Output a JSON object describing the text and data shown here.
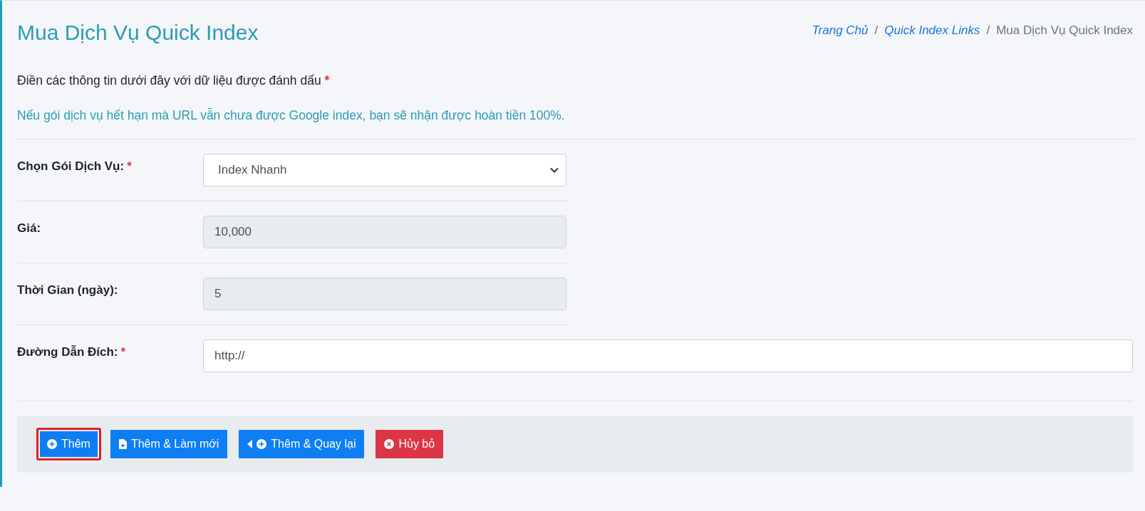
{
  "page_title": "Mua Dịch Vụ Quick Index",
  "breadcrumb": [
    {
      "label": "Trang Chủ",
      "link": true
    },
    {
      "label": "Quick Index Links",
      "link": true
    },
    {
      "label": "Mua Dịch Vụ Quick Index",
      "link": false
    }
  ],
  "breadcrumb_separator": "/",
  "intro": {
    "text": "Điền các thông tin dưới đây với dữ liệu được đánh dấu",
    "required_mark": "*"
  },
  "note": "Nếu gói dịch vụ hết hạn mà URL vẫn chưa được Google index, bạn sẽ nhận được hoàn tiền 100%.",
  "fields": [
    {
      "kind": "select",
      "label": "Chọn Gói Dịch Vụ:",
      "required_mark": "*",
      "value": "Index Nhanh",
      "readonly": false
    },
    {
      "kind": "text",
      "label": "Giá:",
      "value": "10,000",
      "readonly": true
    },
    {
      "kind": "text",
      "label": "Thời Gian (ngày):",
      "value": "5",
      "readonly": true
    },
    {
      "kind": "url",
      "label": "Đường Dẫn Đích:",
      "required_mark": "*",
      "value": "http://",
      "readonly": false
    }
  ],
  "buttons": [
    {
      "label": "Thêm",
      "kind": "add",
      "highlighted": true
    },
    {
      "label": "Thêm & Làm mới",
      "kind": "renew",
      "highlighted": false
    },
    {
      "label": "Thêm & Quay lại",
      "kind": "back",
      "highlighted": false
    },
    {
      "label": "Hủy bỏ",
      "kind": "cancel",
      "highlighted": false
    }
  ]
}
